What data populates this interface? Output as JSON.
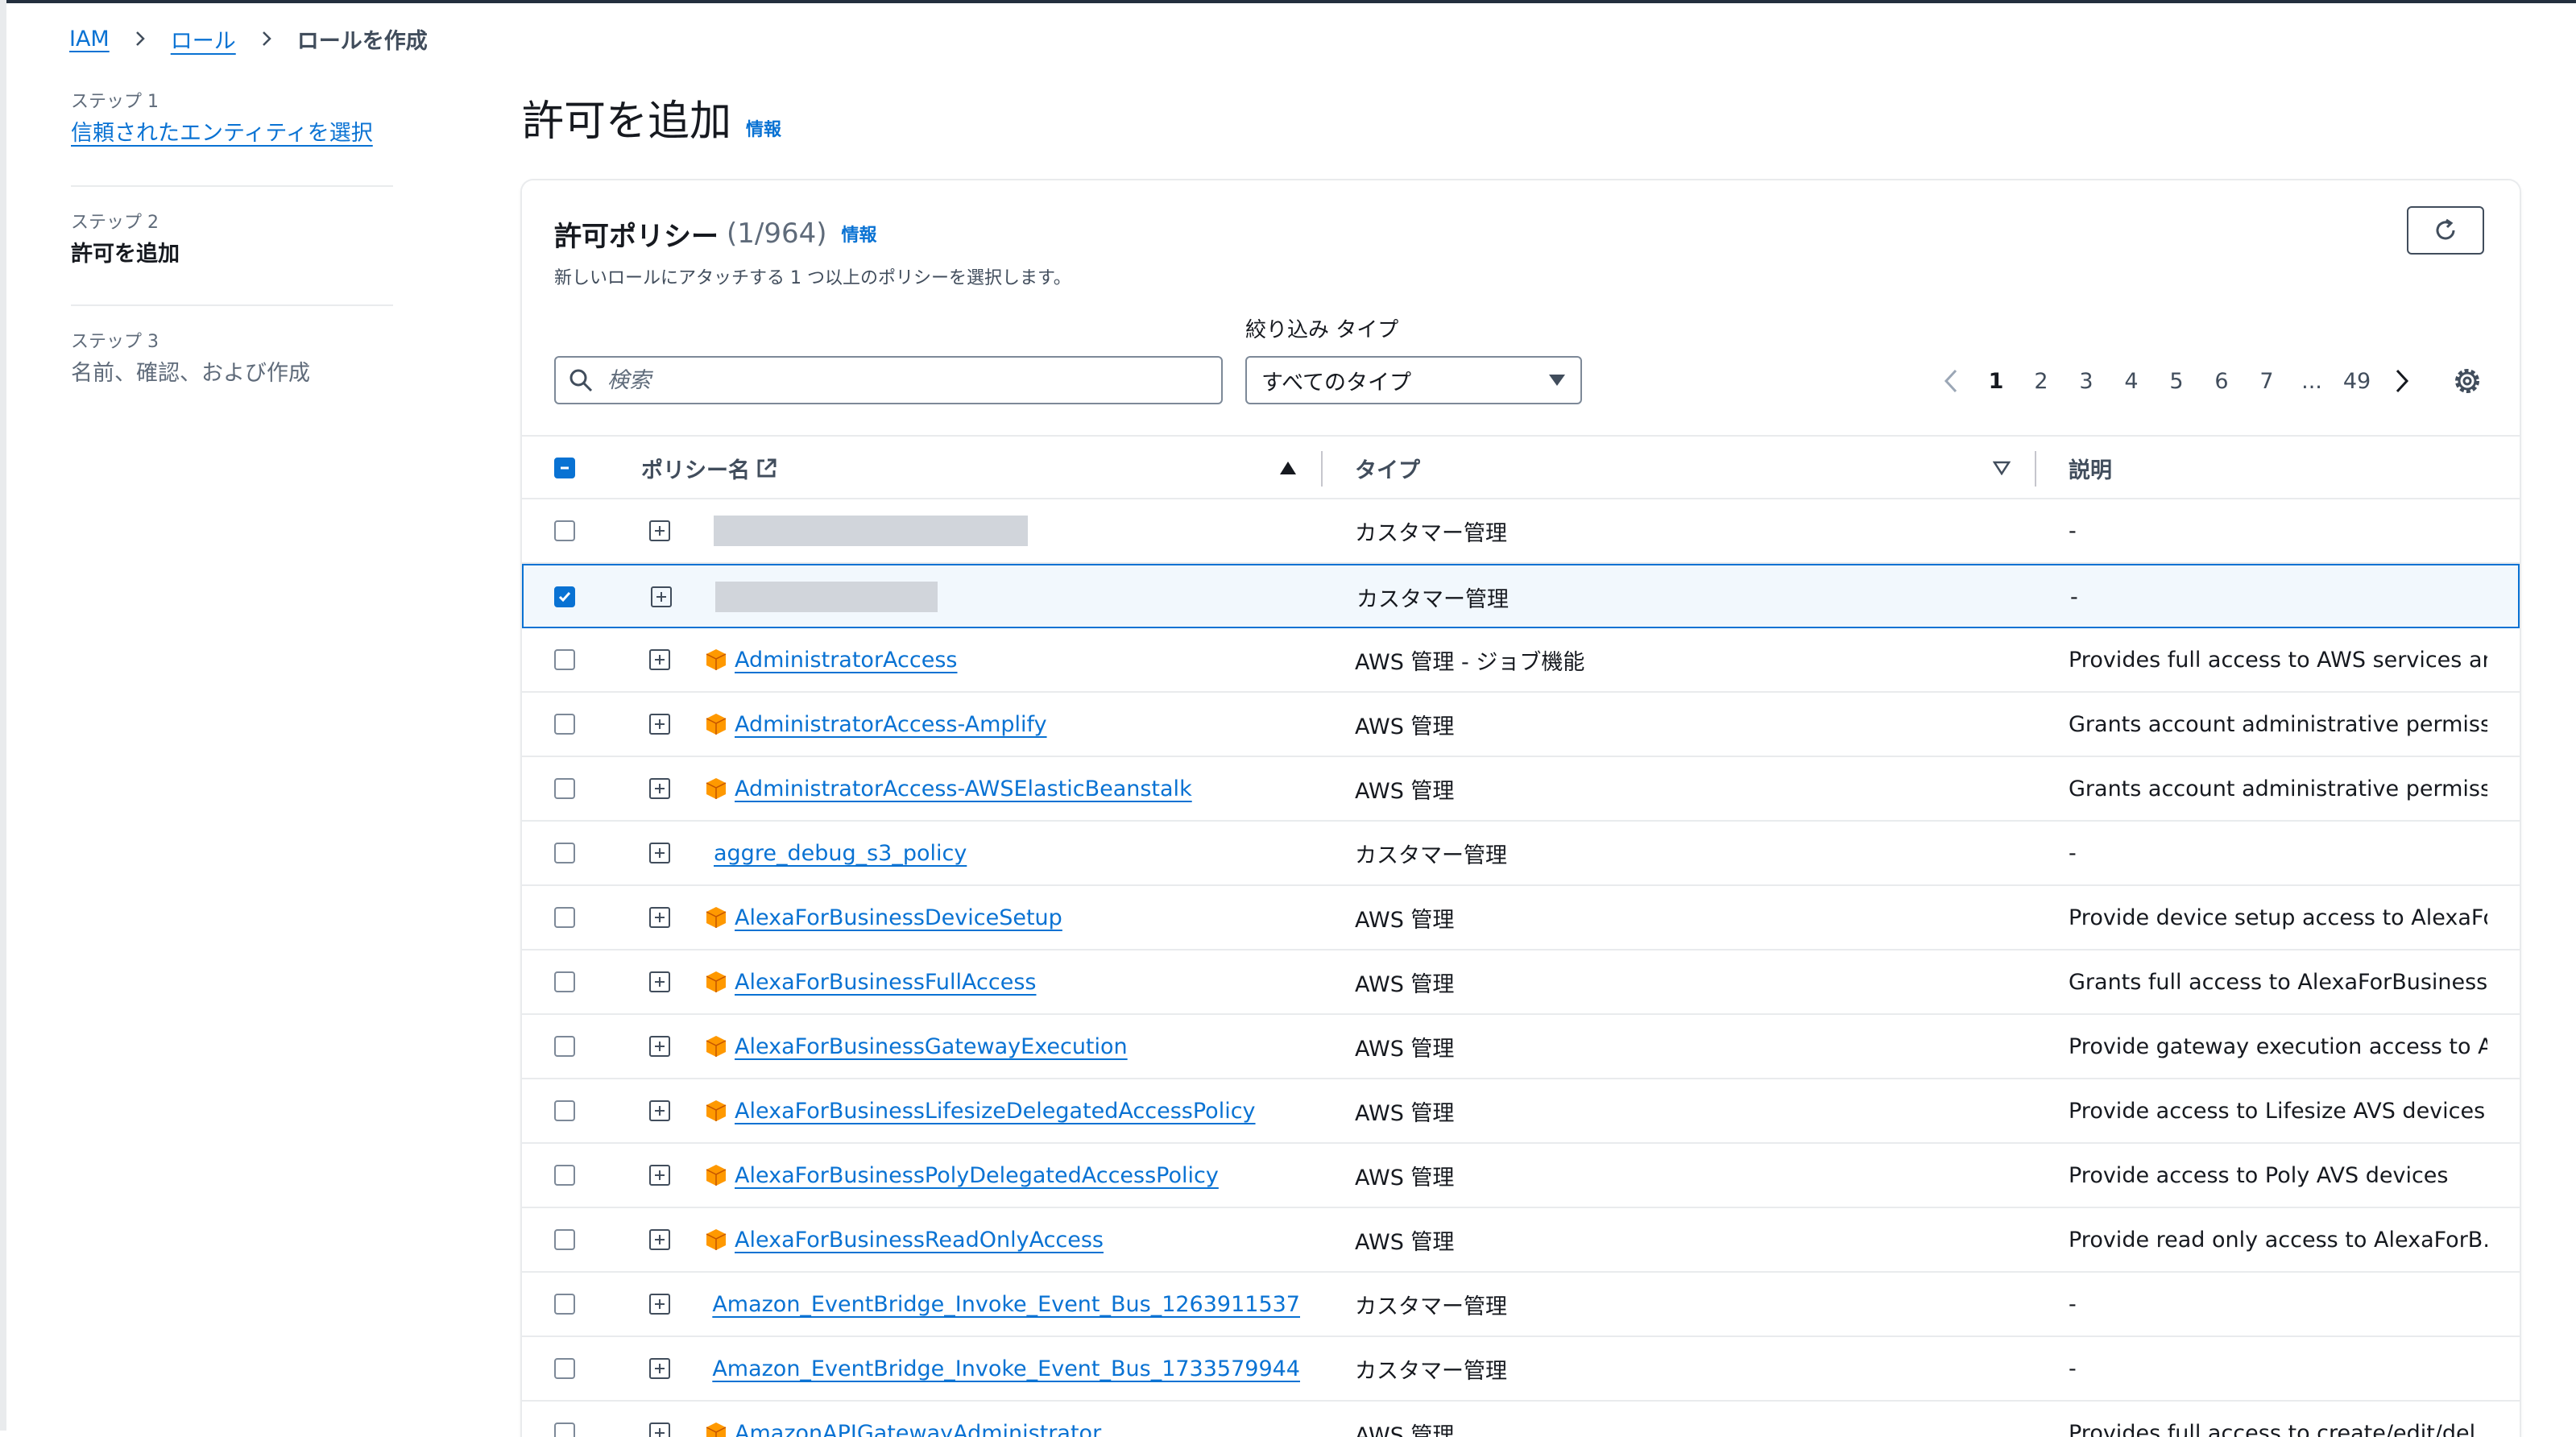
{
  "breadcrumb": {
    "items": [
      "IAM",
      "ロール"
    ],
    "current": "ロールを作成"
  },
  "steps": [
    {
      "num": "ステップ 1",
      "label": "信頼されたエンティティを選択"
    },
    {
      "num": "ステップ 2",
      "label": "許可を追加"
    },
    {
      "num": "ステップ 3",
      "label": "名前、確認、および作成"
    }
  ],
  "page": {
    "title": "許可を追加",
    "info": "情報"
  },
  "policies": {
    "title": "許可ポリシー",
    "count": "(1/964)",
    "info": "情報",
    "description": "新しいロールにアタッチする 1 つ以上のポリシーを選択します。",
    "search_placeholder": "検索",
    "filter_label": "絞り込み タイプ",
    "filter_value": "すべてのタイプ"
  },
  "pagination": {
    "pages": [
      "1",
      "2",
      "3",
      "4",
      "5",
      "6",
      "7",
      "...",
      "49"
    ],
    "current": "1"
  },
  "columns": {
    "name": "ポリシー名",
    "type": "タイプ",
    "description": "説明"
  },
  "rows": [
    {
      "name": "",
      "type": "カスタマー管理",
      "description": "-",
      "checked": false,
      "redacted": true,
      "aws": false
    },
    {
      "name": "",
      "type": "カスタマー管理",
      "description": "-",
      "checked": true,
      "redacted": true,
      "aws": false
    },
    {
      "name": "AdministratorAccess",
      "type": "AWS 管理 - ジョブ機能",
      "description": "Provides full access to AWS services an...",
      "checked": false,
      "redacted": false,
      "aws": true
    },
    {
      "name": "AdministratorAccess-Amplify",
      "type": "AWS 管理",
      "description": "Grants account administrative permiss...",
      "checked": false,
      "redacted": false,
      "aws": true
    },
    {
      "name": "AdministratorAccess-AWSElasticBeanstalk",
      "type": "AWS 管理",
      "description": "Grants account administrative permiss...",
      "checked": false,
      "redacted": false,
      "aws": true
    },
    {
      "name": "aggre_debug_s3_policy",
      "type": "カスタマー管理",
      "description": "-",
      "checked": false,
      "redacted": false,
      "aws": false
    },
    {
      "name": "AlexaForBusinessDeviceSetup",
      "type": "AWS 管理",
      "description": "Provide device setup access to AlexaFo...",
      "checked": false,
      "redacted": false,
      "aws": true
    },
    {
      "name": "AlexaForBusinessFullAccess",
      "type": "AWS 管理",
      "description": "Grants full access to AlexaForBusiness ...",
      "checked": false,
      "redacted": false,
      "aws": true
    },
    {
      "name": "AlexaForBusinessGatewayExecution",
      "type": "AWS 管理",
      "description": "Provide gateway execution access to A...",
      "checked": false,
      "redacted": false,
      "aws": true
    },
    {
      "name": "AlexaForBusinessLifesizeDelegatedAccessPolicy",
      "type": "AWS 管理",
      "description": "Provide access to Lifesize AVS devices",
      "checked": false,
      "redacted": false,
      "aws": true
    },
    {
      "name": "AlexaForBusinessPolyDelegatedAccessPolicy",
      "type": "AWS 管理",
      "description": "Provide access to Poly AVS devices",
      "checked": false,
      "redacted": false,
      "aws": true
    },
    {
      "name": "AlexaForBusinessReadOnlyAccess",
      "type": "AWS 管理",
      "description": "Provide read only access to AlexaForB...",
      "checked": false,
      "redacted": false,
      "aws": true
    },
    {
      "name": "Amazon_EventBridge_Invoke_Event_Bus_1263911537",
      "type": "カスタマー管理",
      "description": "-",
      "checked": false,
      "redacted": false,
      "aws": false
    },
    {
      "name": "Amazon_EventBridge_Invoke_Event_Bus_1733579944",
      "type": "カスタマー管理",
      "description": "-",
      "checked": false,
      "redacted": false,
      "aws": false
    },
    {
      "name": "AmazonAPIGatewayAdministrator",
      "type": "AWS 管理",
      "description": "Provides full access to create/edit/del...",
      "checked": false,
      "redacted": false,
      "aws": true
    }
  ],
  "colors": {
    "link": "#0972d3",
    "aws_icon": "#ff9900",
    "selected_row_border": "#0972d3"
  }
}
